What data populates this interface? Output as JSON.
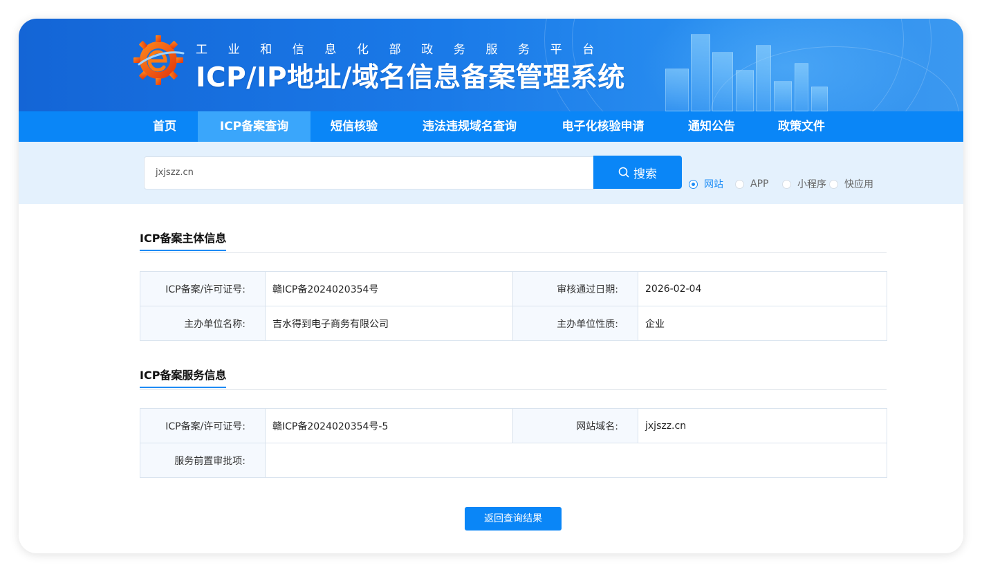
{
  "header": {
    "subtitle": "工业和信息化部政务服务平台",
    "title": "ICP/IP地址/域名信息备案管理系统"
  },
  "nav": {
    "items": [
      {
        "label": "首页"
      },
      {
        "label": "ICP备案查询",
        "active": true
      },
      {
        "label": "短信核验"
      },
      {
        "label": "违法违规域名查询"
      },
      {
        "label": "电子化核验申请"
      },
      {
        "label": "通知公告"
      },
      {
        "label": "政策文件"
      }
    ]
  },
  "search": {
    "value": "jxjszz.cn",
    "button_label": "搜索",
    "options": [
      {
        "label": "网站",
        "checked": true
      },
      {
        "label": "APP",
        "checked": false
      },
      {
        "label": "小程序",
        "checked": false
      },
      {
        "label": "快应用",
        "checked": false
      }
    ]
  },
  "subject_section": {
    "title": "ICP备案主体信息",
    "rows": [
      {
        "k1": "ICP备案/许可证号:",
        "v1": "赣ICP备2024020354号",
        "k2": "审核通过日期:",
        "v2": "2026-02-04"
      },
      {
        "k1": "主办单位名称:",
        "v1": "吉水得到电子商务有限公司",
        "k2": "主办单位性质:",
        "v2": "企业"
      }
    ]
  },
  "service_section": {
    "title": "ICP备案服务信息",
    "rows": [
      {
        "k1": "ICP备案/许可证号:",
        "v1": "赣ICP备2024020354号-5",
        "k2": "网站域名:",
        "v2": "jxjszz.cn"
      },
      {
        "k1": "服务前置审批项:",
        "v1": ""
      }
    ]
  },
  "actions": {
    "back_label": "返回查询结果"
  },
  "colors": {
    "primary": "#0a86f7",
    "nav_active": "#3aa6fb",
    "search_band": "#e4f1fd"
  }
}
